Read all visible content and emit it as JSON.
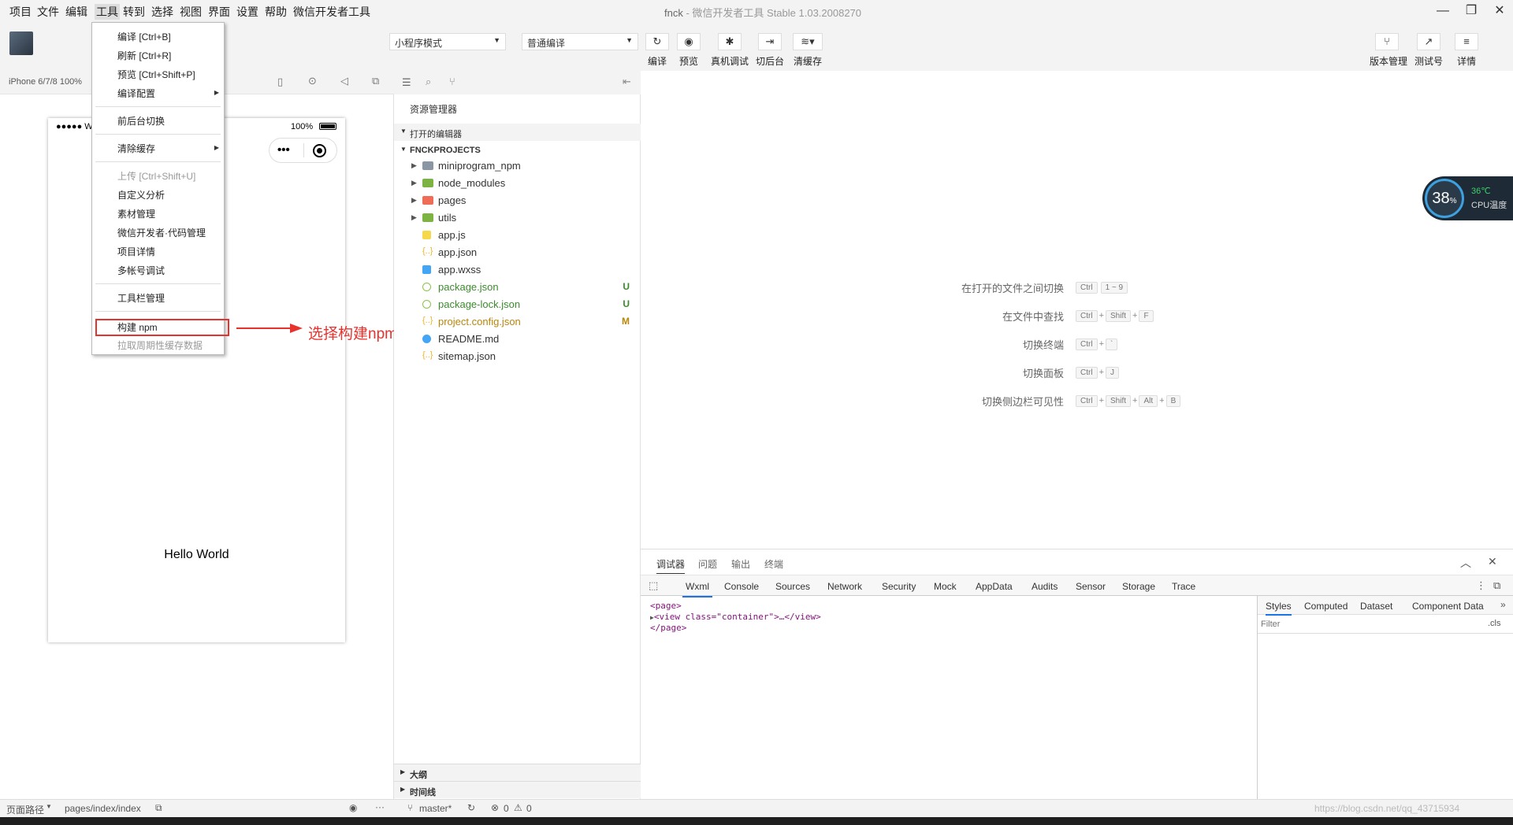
{
  "menubar": {
    "items": [
      "项目",
      "文件",
      "编辑",
      "工具",
      "转到",
      "选择",
      "视图",
      "界面",
      "设置",
      "帮助",
      "微信开发者工具"
    ],
    "title_project": "fnck",
    "title_app": "- 微信开发者工具 Stable 1.03.2008270"
  },
  "toolbar": {
    "mode_select": "小程序模式",
    "compile_select": "普通编译",
    "buttons": [
      "编译",
      "预览",
      "真机调试",
      "切后台",
      "清缓存"
    ],
    "right_buttons": [
      "版本管理",
      "测试号",
      "详情"
    ]
  },
  "simulator": {
    "device": "iPhone 6/7/8 100%",
    "status_signal": "●●●●● W",
    "battery": "100%",
    "capsule_dots": "•••",
    "content": "Hello World"
  },
  "dropdown": {
    "items": [
      {
        "label": "编译  [Ctrl+B]"
      },
      {
        "label": "刷新  [Ctrl+R]"
      },
      {
        "label": "预览  [Ctrl+Shift+P]"
      },
      {
        "label": "编译配置"
      },
      {
        "label": "前后台切换"
      },
      {
        "label": "清除缓存"
      },
      {
        "label": "上传  [Ctrl+Shift+U]"
      },
      {
        "label": "自定义分析"
      },
      {
        "label": "素材管理"
      },
      {
        "label": "微信开发者·代码管理"
      },
      {
        "label": "项目详情"
      },
      {
        "label": "多帐号调试"
      },
      {
        "label": "工具栏管理"
      },
      {
        "label": "构建 npm"
      },
      {
        "label": "拉取周期性缓存数据"
      }
    ]
  },
  "annotation": {
    "text": "选择构建npm",
    "color": "#e8322e"
  },
  "explorer": {
    "title": "资源管理器",
    "open_editors": "打开的编辑器",
    "project": "FNCKPROJECTS",
    "files": [
      {
        "name": "miniprogram_npm",
        "color": "#8a96a3",
        "badge": ""
      },
      {
        "name": "node_modules",
        "color": "#7cb342",
        "badge": ""
      },
      {
        "name": "pages",
        "color": "#ef6c57",
        "badge": ""
      },
      {
        "name": "utils",
        "color": "#7cb342",
        "badge": ""
      },
      {
        "name": "app.js",
        "color": "#f5d94a",
        "badge": ""
      },
      {
        "name": "app.json",
        "color": "#f0b429",
        "badge": ""
      },
      {
        "name": "app.wxss",
        "color": "#42a5f5",
        "badge": ""
      },
      {
        "name": "package.json",
        "color": "#8bc34a",
        "badge": "U"
      },
      {
        "name": "package-lock.json",
        "color": "#8bc34a",
        "badge": "U"
      },
      {
        "name": "project.config.json",
        "color": "#f0b429",
        "badge": "M"
      },
      {
        "name": "README.md",
        "color": "#42a5f5",
        "badge": ""
      },
      {
        "name": "sitemap.json",
        "color": "#f0b429",
        "badge": ""
      }
    ],
    "outline": "大纲",
    "timeline": "时间线"
  },
  "editor_hints": [
    {
      "label": "在打开的文件之间切换",
      "keys": [
        "Ctrl",
        "1 ~ 9"
      ]
    },
    {
      "label": "在文件中查找",
      "keys": [
        "Ctrl",
        "Shift",
        "F"
      ]
    },
    {
      "label": "切换终端",
      "keys": [
        "Ctrl",
        "`"
      ]
    },
    {
      "label": "切换面板",
      "keys": [
        "Ctrl",
        "J"
      ]
    },
    {
      "label": "切换侧边栏可见性",
      "keys": [
        "Ctrl",
        "Shift",
        "Alt",
        "B"
      ]
    }
  ],
  "cpu_widget": {
    "value": "38",
    "unit": "%",
    "temp": "36℃",
    "label": "CPU温度"
  },
  "devtools": {
    "top_tabs": [
      "调试器",
      "问题",
      "输出",
      "终端"
    ],
    "tabs": [
      "Wxml",
      "Console",
      "Sources",
      "Network",
      "Security",
      "Mock",
      "AppData",
      "Audits",
      "Sensor",
      "Storage",
      "Trace"
    ],
    "wxml_lines": [
      "<page>",
      "<view class=\"container\">…</view>",
      "</page>"
    ],
    "side_tabs": [
      "Styles",
      "Computed",
      "Dataset",
      "Component Data"
    ],
    "filter_placeholder": "Filter",
    "cls": ".cls"
  },
  "statusbar": {
    "page_path_label": "页面路径",
    "page_path": "pages/index/index",
    "branch": "master*",
    "errors": "0",
    "warnings": "0",
    "watermark": "https://blog.csdn.net/qq_43715934"
  }
}
